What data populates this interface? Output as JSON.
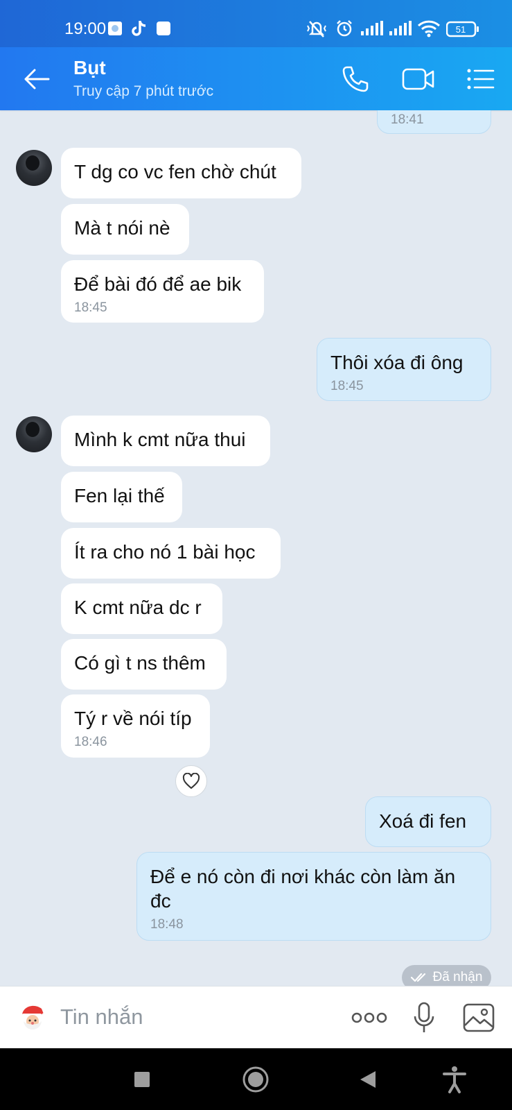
{
  "status_bar": {
    "time": "19:00",
    "battery": "51"
  },
  "header": {
    "contact_name": "Bụt",
    "last_seen": "Truy cập 7 phút trước"
  },
  "messages": {
    "top_time": "18:41",
    "m1": "T dg co vc fen chờ chút",
    "m2": "Mà t nói nè",
    "m3": "Để bài đó để ae bik",
    "m3_time": "18:45",
    "m4": "Thôi xóa đi ông",
    "m4_time": "18:45",
    "m5": "Mình k cmt nữa thui",
    "m6": "Fen lại thế",
    "m7": "Ít ra cho nó 1 bài học",
    "m8": "K cmt nữa dc r",
    "m9": "Có gì t ns thêm",
    "m10": "Tý r về nói típ",
    "m10_time": "18:46",
    "m11": "Xoá đi fen",
    "m12": "Để e nó còn đi nơi khác còn làm ăn đc",
    "m12_time": "18:48",
    "status": "Đã nhận"
  },
  "input": {
    "placeholder": "Tin nhắn"
  },
  "icons": {
    "back": "arrow-left-icon",
    "call": "phone-icon",
    "video": "video-camera-icon",
    "menu": "list-menu-icon",
    "sticker": "santa-emoji-icon",
    "more": "more-dots-icon",
    "mic": "microphone-icon",
    "gallery": "image-icon"
  },
  "colors": {
    "header_start": "#2278f0",
    "header_end": "#19a8f2",
    "outgoing_bubble": "#d6ecfb",
    "chat_bg": "#e2e9f1"
  }
}
